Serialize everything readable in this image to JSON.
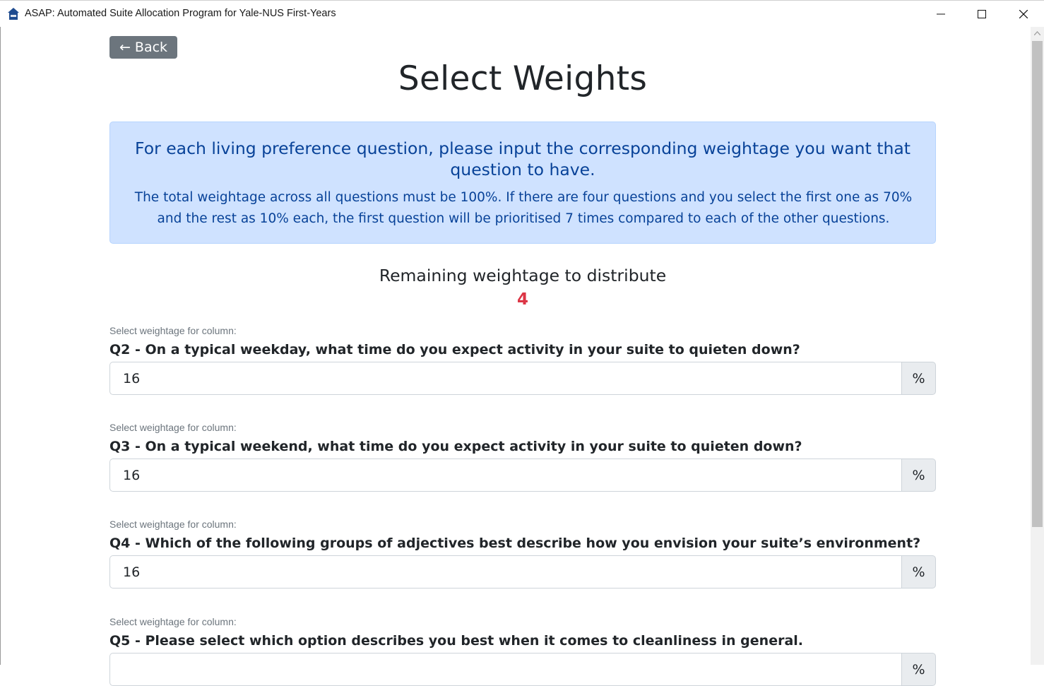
{
  "window": {
    "title": "ASAP: Automated Suite Allocation Program for Yale-NUS First-Years"
  },
  "nav": {
    "back_label": "← Back"
  },
  "page": {
    "title": "Select Weights"
  },
  "alert": {
    "lead": "For each living preference question, please input the corresponding weightage you want that question to have.",
    "body": "The total weightage across all questions must be 100%. If there are four questions and you select the first one as 70% and the rest as 10% each, the first question will be prioritised 7 times compared to each of the other questions."
  },
  "remaining": {
    "label": "Remaining weightage to distribute",
    "value": "4"
  },
  "weights": [
    {
      "caption": "Select weightage for column:",
      "question": "Q2 - On a typical weekday, what time do you expect activity in your suite to quieten down?",
      "value": "16",
      "suffix": "%"
    },
    {
      "caption": "Select weightage for column:",
      "question": "Q3 - On a typical weekend, what time do you expect activity in your suite to quieten down?",
      "value": "16",
      "suffix": "%"
    },
    {
      "caption": "Select weightage for column:",
      "question": "Q4 - Which of the following groups of adjectives best describe how you envision your suite’s environment?",
      "value": "16",
      "suffix": "%"
    },
    {
      "caption": "Select weightage for column:",
      "question": "Q5 - Please select which option describes you best when it comes to cleanliness in general.",
      "value": "",
      "suffix": "%"
    }
  ],
  "colors": {
    "alert_bg": "#cfe2ff",
    "alert_text": "#084298",
    "remaining_value": "#dc3545",
    "back_button": "#6c757d"
  }
}
